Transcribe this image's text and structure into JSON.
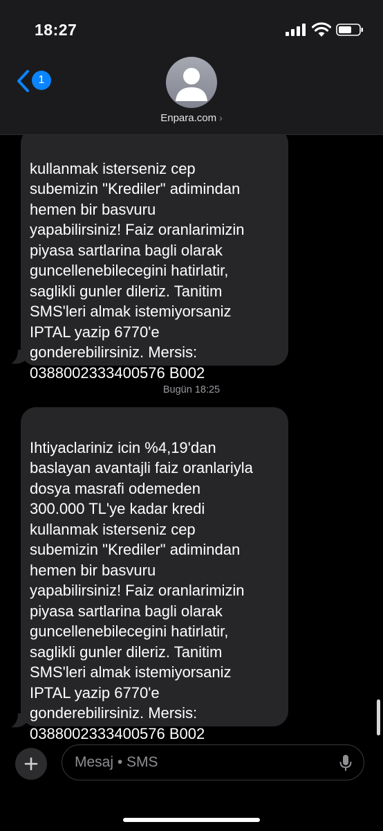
{
  "status_bar": {
    "time": "18:27"
  },
  "header": {
    "back_badge": "1",
    "contact_name": "Enpara.com",
    "contact_chevron": "›"
  },
  "messages": [
    {
      "text": "kullanmak isterseniz cep\nsubemizin \"Krediler\" adimindan\nhemen bir basvuru\nyapabilirsiniz! Faiz oranlarimizin\npiyasa sartlarina bagli olarak\nguncellenebilecegini hatirlatir,\nsaglikli gunler dileriz. Tanitim\nSMS'leri almak istemiyorsaniz\nIPTAL yazip 6770'e\ngonderebilirsiniz. Mersis:\n0388002333400576 B002"
    },
    {
      "text": "Ihtiyaclariniz icin %4,19'dan\nbaslayan avantajli faiz oranlariyla\ndosya masrafi odemeden\n300.000 TL'ye kadar kredi\nkullanmak isterseniz cep\nsubemizin \"Krediler\" adimindan\nhemen bir basvuru\nyapabilirsiniz! Faiz oranlarimizin\npiyasa sartlarina bagli olarak\nguncellenebilecegini hatirlatir,\nsaglikli gunler dileriz. Tanitim\nSMS'leri almak istemiyorsaniz\nIPTAL yazip 6770'e\ngonderebilirsiniz. Mersis:\n0388002333400576 B002"
    }
  ],
  "timestamp": "Bugün 18:25",
  "input": {
    "placeholder": "Mesaj • SMS"
  },
  "colors": {
    "accent": "#0a84ff",
    "bubble": "#262629",
    "background": "#000000"
  }
}
